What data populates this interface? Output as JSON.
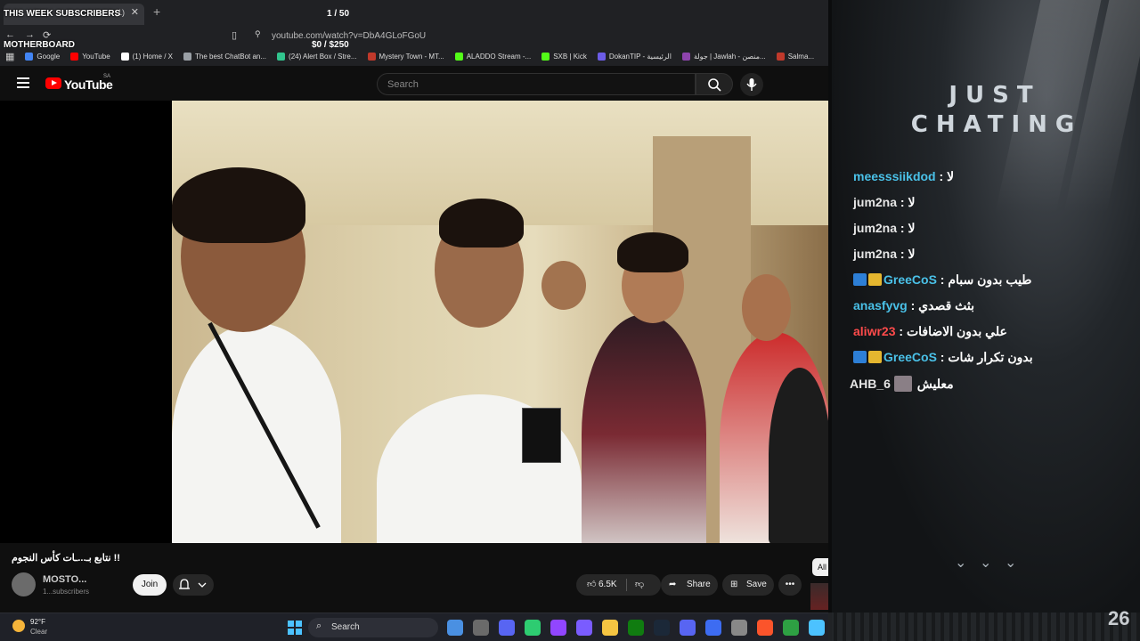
{
  "overlay": {
    "subscribers_label": "THIS WEEK SUBSCRIBERS",
    "motherboard_label": "MOTHERBOARD",
    "counter": "1 / 50",
    "money": "$0 / $250"
  },
  "browser": {
    "tab_count": "(1)",
    "url": "youtube.com/watch?v=DbA4GLoFGoU",
    "bookmarks": [
      {
        "label": "Google",
        "color": "#4285f4"
      },
      {
        "label": "YouTube",
        "color": "#ff0000"
      },
      {
        "label": "(1) Home / X",
        "color": "#ffffff"
      },
      {
        "label": "The best ChatBot an...",
        "color": "#9aa0a6"
      },
      {
        "label": "(24) Alert Box / Stre...",
        "color": "#31c48d"
      },
      {
        "label": "Mystery Town - MT...",
        "color": "#c0392b"
      },
      {
        "label": "ALADDO Stream -...",
        "color": "#53fc18"
      },
      {
        "label": "SXB | Kick",
        "color": "#53fc18"
      },
      {
        "label": "DokanTIP - الرئيسية",
        "color": "#6c5ce7"
      },
      {
        "label": "جولة | Jawlah - منصن...",
        "color": "#8e44ad"
      },
      {
        "label": "Salma...",
        "color": "#c0392b"
      }
    ]
  },
  "youtube": {
    "logo_text": "YouTube",
    "region": "SA",
    "search_placeholder": "Search",
    "video_title": "نتابع بـ...ـات كأس النجوم !!",
    "channel_name": "MOSTO...",
    "channel_subs": "1...subscribers",
    "join_label": "Join",
    "like_count": "6.5K",
    "share_label": "Share",
    "save_label": "Save",
    "all_chip": "All"
  },
  "taskbar": {
    "temperature": "92°F",
    "condition": "Clear",
    "search_label": "Search",
    "icons": [
      "#4a90e2",
      "#6a6a6a",
      "#5865f2",
      "#2ecc71",
      "#9146ff",
      "#7a5cff",
      "#f5c542",
      "#107c10",
      "#1b2838",
      "#5865f2",
      "#3d6cf2",
      "#888888",
      "#fb542b",
      "#2ea043",
      "#4cc2ff"
    ]
  },
  "stream": {
    "title_line1": "JUST",
    "title_line2": "CHATING",
    "bottom_number": "26",
    "chat": [
      {
        "user": "meesssiikdod",
        "text": "لا",
        "color": "blue",
        "badges": []
      },
      {
        "user": "jum2na",
        "text": "لا",
        "color": "white",
        "badges": []
      },
      {
        "user": "jum2na",
        "text": "لا",
        "color": "white",
        "badges": []
      },
      {
        "user": "jum2na",
        "text": "لا",
        "color": "white",
        "badges": []
      },
      {
        "user": "GreeCoS",
        "text": "طيب بدون سبام",
        "color": "blue",
        "badges": [
          "blue",
          "gold"
        ]
      },
      {
        "user": "anasfyvg",
        "text": "بثث قصدي",
        "color": "blue",
        "badges": []
      },
      {
        "user": "aliwr23",
        "text": "علي بدون الاضافات",
        "color": "red",
        "badges": []
      },
      {
        "user": "GreeCoS",
        "text": "بدون تكرار شات",
        "color": "blue",
        "badges": [
          "blue",
          "gold"
        ]
      },
      {
        "user": "AHB_6",
        "text": "معليش",
        "color": "white",
        "badges": [
          "avatar"
        ]
      }
    ]
  }
}
